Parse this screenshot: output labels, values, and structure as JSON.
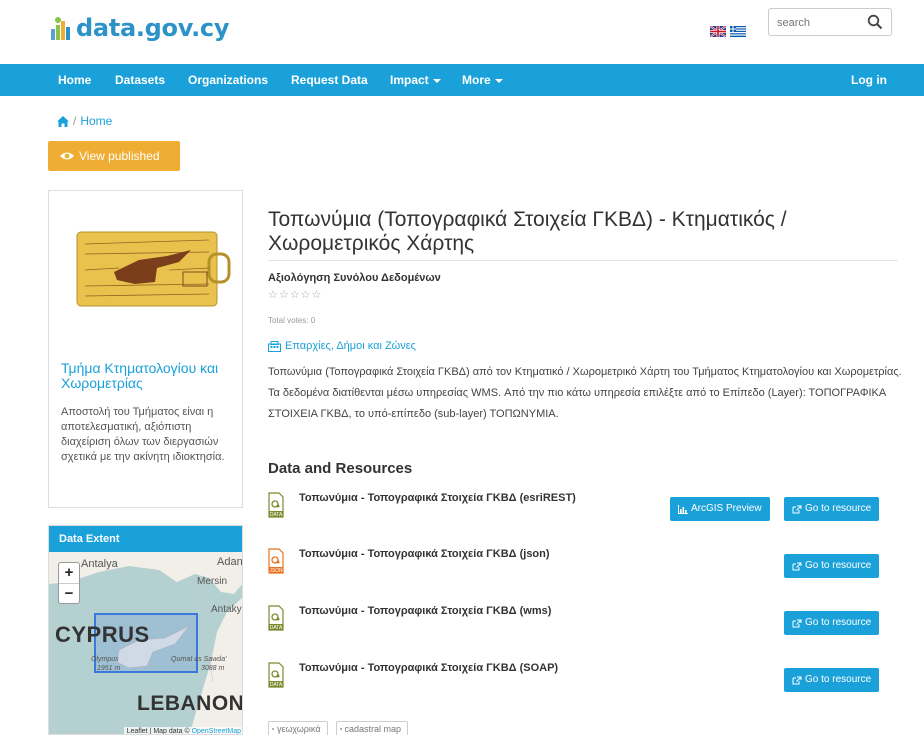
{
  "header": {
    "logo_text": "data.gov.cy",
    "search": {
      "placeholder": "search",
      "value": ""
    }
  },
  "nav": {
    "items": [
      "Home",
      "Datasets",
      "Organizations",
      "Request Data",
      "Impact",
      "More"
    ],
    "login": "Log in"
  },
  "breadcrumb": {
    "home": "Home"
  },
  "view_published": "View published",
  "organization": {
    "name": "Τμήμα Κτηματολογίου και Χωρομετρίας",
    "description": "Αποστολή του Τμήματος είναι η αποτελεσματική, αξιόπιστη διαχείριση όλων των διεργασιών σχετικά με την ακίνητη ιδιοκτησία."
  },
  "extent": {
    "heading": "Data Extent",
    "zoom_in": "+",
    "zoom_out": "−",
    "labels": {
      "cyprus": "CYPRUS",
      "lebanon": "LEBANON",
      "antalya": "Antalya",
      "adana": "Adana",
      "mersin": "Mersin",
      "antakya": "Antakya",
      "olympus": "Olympus",
      "olympus_elev": "1951 m",
      "qurnat": "Qurnat as Sawda'",
      "qurnat_elev": "3088 m"
    },
    "attribution_prefix": "Leaflet | Map data © ",
    "attribution_link": "OpenStreetMap"
  },
  "dataset": {
    "title": "Τοπωνύμια (Τοπογραφικά Στοιχεία ΓΚΒΔ) - Κτηματικός / Χωρομετρικός Χάρτης",
    "rating_label": "Αξιολόγηση Συνόλου Δεδομένων",
    "stars": "☆☆☆☆☆",
    "votes": "Total votes: 0",
    "group": "Επαρχίες, Δήμοι και Ζώνες",
    "description": "Τοπωνύμια (Τοπογραφικά Στοιχεία ΓΚΒΔ) από τον Κτηματικό / Χωρομετρικό Χάρτη του Τμήματος Κτηματολογίου και Χωρομετρίας. Τα δεδομένα διατίθενται μέσω υπηρεσίας WMS. Από την πιο κάτω υπηρεσία επιλέξτε από το Επίπεδο (Layer): ΤΟΠΟΓΡΑΦΙΚΑ ΣΤΟΙΧΕΙΑ ΓΚΒΔ, το υπό-επίπεδο (sub-layer) ΤΟΠΩΝΥΜΙΑ."
  },
  "resources": {
    "heading": "Data and Resources",
    "items": [
      {
        "title": "Τοπωνύμια - Τοπογραφικά Στοιχεία ΓΚΒΔ (esriREST)",
        "format": "DATA",
        "preview": "ArcGIS Preview",
        "go": "Go to resource"
      },
      {
        "title": "Τοπωνύμια - Τοπογραφικά Στοιχεία ΓΚΒΔ (json)",
        "format": "JSON",
        "go": "Go to resource"
      },
      {
        "title": "Τοπωνύμια - Τοπογραφικά Στοιχεία ΓΚΒΔ (wms)",
        "format": "DATA",
        "go": "Go to resource"
      },
      {
        "title": "Τοπωνύμια - Τοπογραφικά Στοιχεία ΓΚΒΔ (SOAP)",
        "format": "DATA",
        "go": "Go to resource"
      }
    ]
  },
  "tags": [
    "γεωχωρικά",
    "cadastral map"
  ],
  "colors": {
    "primary": "#1aa1d9",
    "warning": "#f0ad34",
    "logo": "#2c93c9",
    "json_icon": "#e8711d",
    "data_icon": "#7a8b2e"
  },
  "icons": [
    "home-icon",
    "eye-icon",
    "search-icon",
    "building-icon",
    "chart-icon",
    "external-link-icon",
    "data-file-icon",
    "json-file-icon"
  ]
}
